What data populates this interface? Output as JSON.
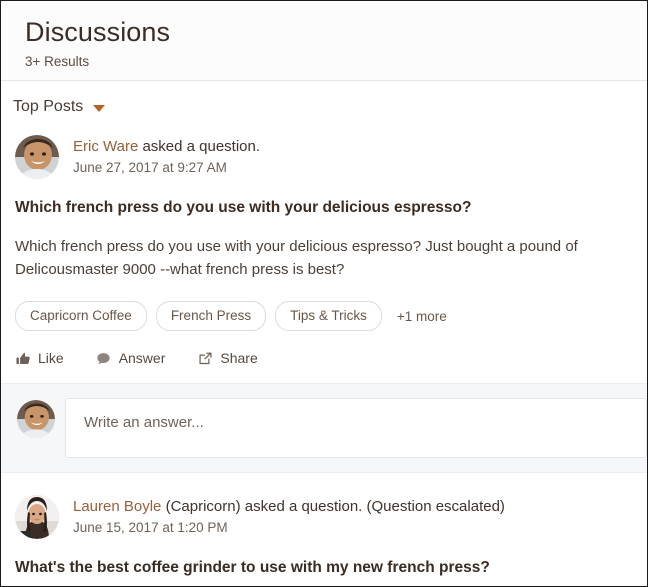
{
  "header": {
    "title": "Discussions",
    "results": "3+ Results"
  },
  "sort": {
    "label": "Top Posts",
    "caret_icon": "caret-down-icon",
    "accent_color": "#b5651d"
  },
  "posts": [
    {
      "author": "Eric Ware",
      "action_text": " asked a question.",
      "timestamp": "June 27, 2017 at 9:27 AM",
      "title": "Which french press do you use with your delicious espresso?",
      "body": "Which french press do you use with your delicious espresso? Just bought a pound of Delicousmaster 9000 --what french press is best?",
      "tags": [
        "Capricorn Coffee",
        "French Press",
        "Tips & Tricks"
      ],
      "more_tags": "+1 more",
      "actions": [
        {
          "label": "Like",
          "icon": "thumbs-up-icon"
        },
        {
          "label": "Answer",
          "icon": "speech-bubble-icon"
        },
        {
          "label": "Share",
          "icon": "share-icon"
        }
      ],
      "answer_placeholder": "Write an answer..."
    },
    {
      "author": "Lauren Boyle",
      "action_text": " (Capricorn) asked a question. (Question escalated)",
      "timestamp": "June 15, 2017 at 1:20 PM",
      "title": "What's the best coffee grinder to use with my new french press?"
    }
  ],
  "colors": {
    "link": "#96603a",
    "accent": "#b5651d",
    "text": "#3a2c22"
  }
}
